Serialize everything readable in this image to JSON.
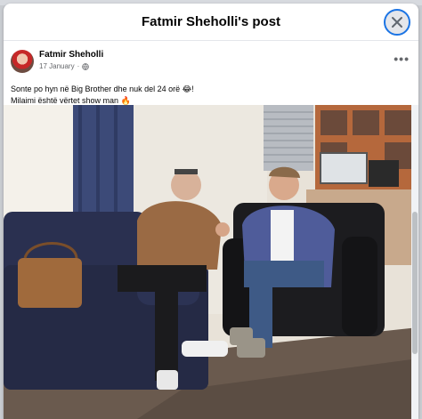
{
  "modal": {
    "title": "Fatmir Sheholli's post"
  },
  "post": {
    "author": "Fatmir Sheholli",
    "date": "17 January",
    "separator": "·",
    "privacy_icon": "globe-icon",
    "line1": "Sonte po hyn në Big Brother dhe nuk del 24 orë 😂!",
    "line2": "Milaimi është vërtet show man 🔥"
  },
  "colors": {
    "accent": "#1b74e4",
    "text_primary": "#050505",
    "text_secondary": "#65676b"
  }
}
